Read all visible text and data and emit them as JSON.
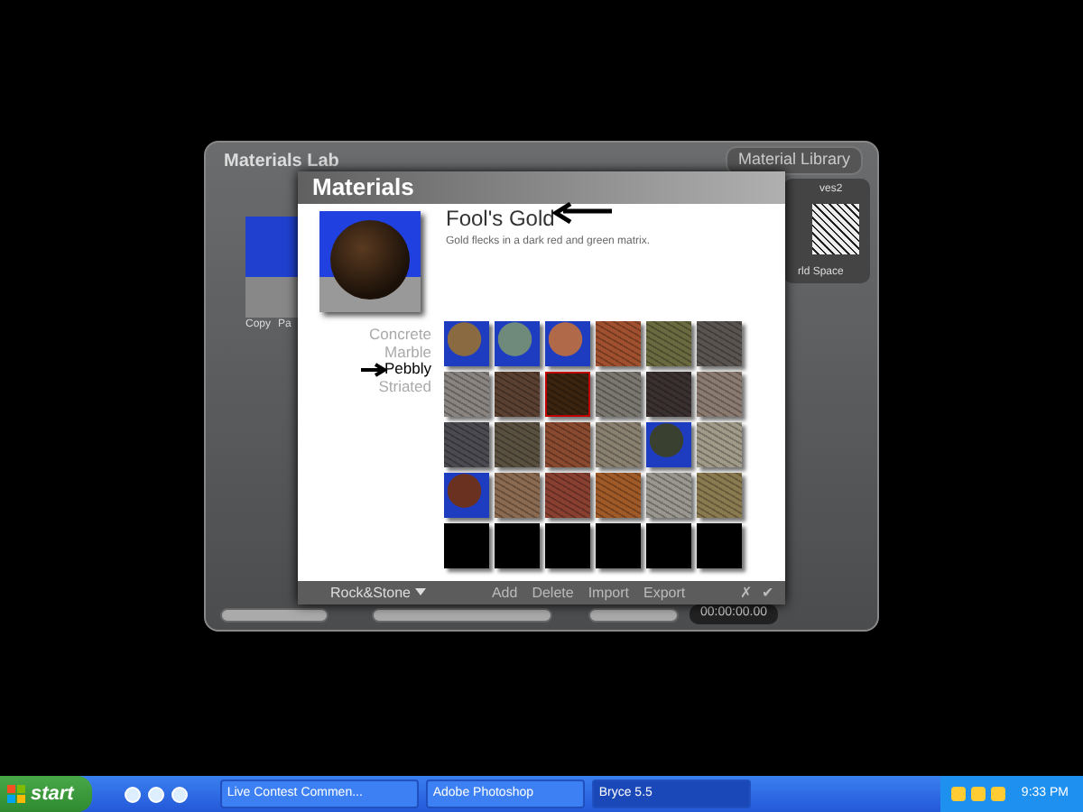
{
  "lab_window": {
    "title": "Materials Lab",
    "library_tab": "Material Library",
    "left_preview_labels": [
      "Copy",
      "Pa"
    ],
    "right_library_labels": [
      "ves2",
      "rld Space"
    ],
    "timecode": "00:00:00.00"
  },
  "materials_panel": {
    "title": "Materials",
    "material_name": "Fool's Gold",
    "description": "Gold flecks in a dark red and green matrix.",
    "categories": [
      {
        "label": "Concrete",
        "selected": false
      },
      {
        "label": "Marble",
        "selected": false
      },
      {
        "label": "Pebbly",
        "selected": true
      },
      {
        "label": "Striated",
        "selected": false
      }
    ],
    "swatches": [
      {
        "kind": "sphere",
        "color": "#8a6a40",
        "selected": false
      },
      {
        "kind": "sphere",
        "color": "#6f8a7a",
        "selected": false
      },
      {
        "kind": "sphere",
        "color": "#b06a4a",
        "selected": false
      },
      {
        "kind": "texture",
        "color": "#a0502e",
        "selected": false
      },
      {
        "kind": "texture",
        "color": "#6a6a40",
        "selected": false
      },
      {
        "kind": "texture",
        "color": "#5a5450",
        "selected": false
      },
      {
        "kind": "texture",
        "color": "#8a8480",
        "selected": false
      },
      {
        "kind": "texture",
        "color": "#5a4030",
        "selected": false
      },
      {
        "kind": "texture",
        "color": "#3a2410",
        "selected": true
      },
      {
        "kind": "texture",
        "color": "#7a7670",
        "selected": false
      },
      {
        "kind": "texture",
        "color": "#3a3030",
        "selected": false
      },
      {
        "kind": "texture",
        "color": "#8a7a70",
        "selected": false
      },
      {
        "kind": "texture",
        "color": "#4a4a50",
        "selected": false
      },
      {
        "kind": "texture",
        "color": "#5a5040",
        "selected": false
      },
      {
        "kind": "texture",
        "color": "#8a4a30",
        "selected": false
      },
      {
        "kind": "texture",
        "color": "#8a8070",
        "selected": false
      },
      {
        "kind": "sphere",
        "color": "#3a4030",
        "selected": false
      },
      {
        "kind": "texture",
        "color": "#a09a88",
        "selected": false
      },
      {
        "kind": "sphere",
        "color": "#6a3020",
        "selected": false
      },
      {
        "kind": "texture",
        "color": "#8a6a50",
        "selected": false
      },
      {
        "kind": "texture",
        "color": "#8a4030",
        "selected": false
      },
      {
        "kind": "texture",
        "color": "#a05a28",
        "selected": false
      },
      {
        "kind": "texture",
        "color": "#9a9690",
        "selected": false
      },
      {
        "kind": "texture",
        "color": "#8a7a50",
        "selected": false
      },
      {
        "kind": "empty",
        "color": "#000000",
        "selected": false
      },
      {
        "kind": "empty",
        "color": "#000000",
        "selected": false
      },
      {
        "kind": "empty",
        "color": "#000000",
        "selected": false
      },
      {
        "kind": "empty",
        "color": "#000000",
        "selected": false
      },
      {
        "kind": "empty",
        "color": "#000000",
        "selected": false
      },
      {
        "kind": "empty",
        "color": "#000000",
        "selected": false
      }
    ],
    "library_menu": "Rock&Stone",
    "actions": [
      "Add",
      "Delete",
      "Import",
      "Export"
    ],
    "cancel": "✗",
    "confirm": "✔"
  },
  "taskbar": {
    "start": "start",
    "tasks": [
      {
        "label": "Live Contest Commen...",
        "selected": false
      },
      {
        "label": "Adobe Photoshop",
        "selected": false
      },
      {
        "label": "Bryce 5.5",
        "selected": true
      }
    ],
    "clock": "9:33 PM"
  }
}
